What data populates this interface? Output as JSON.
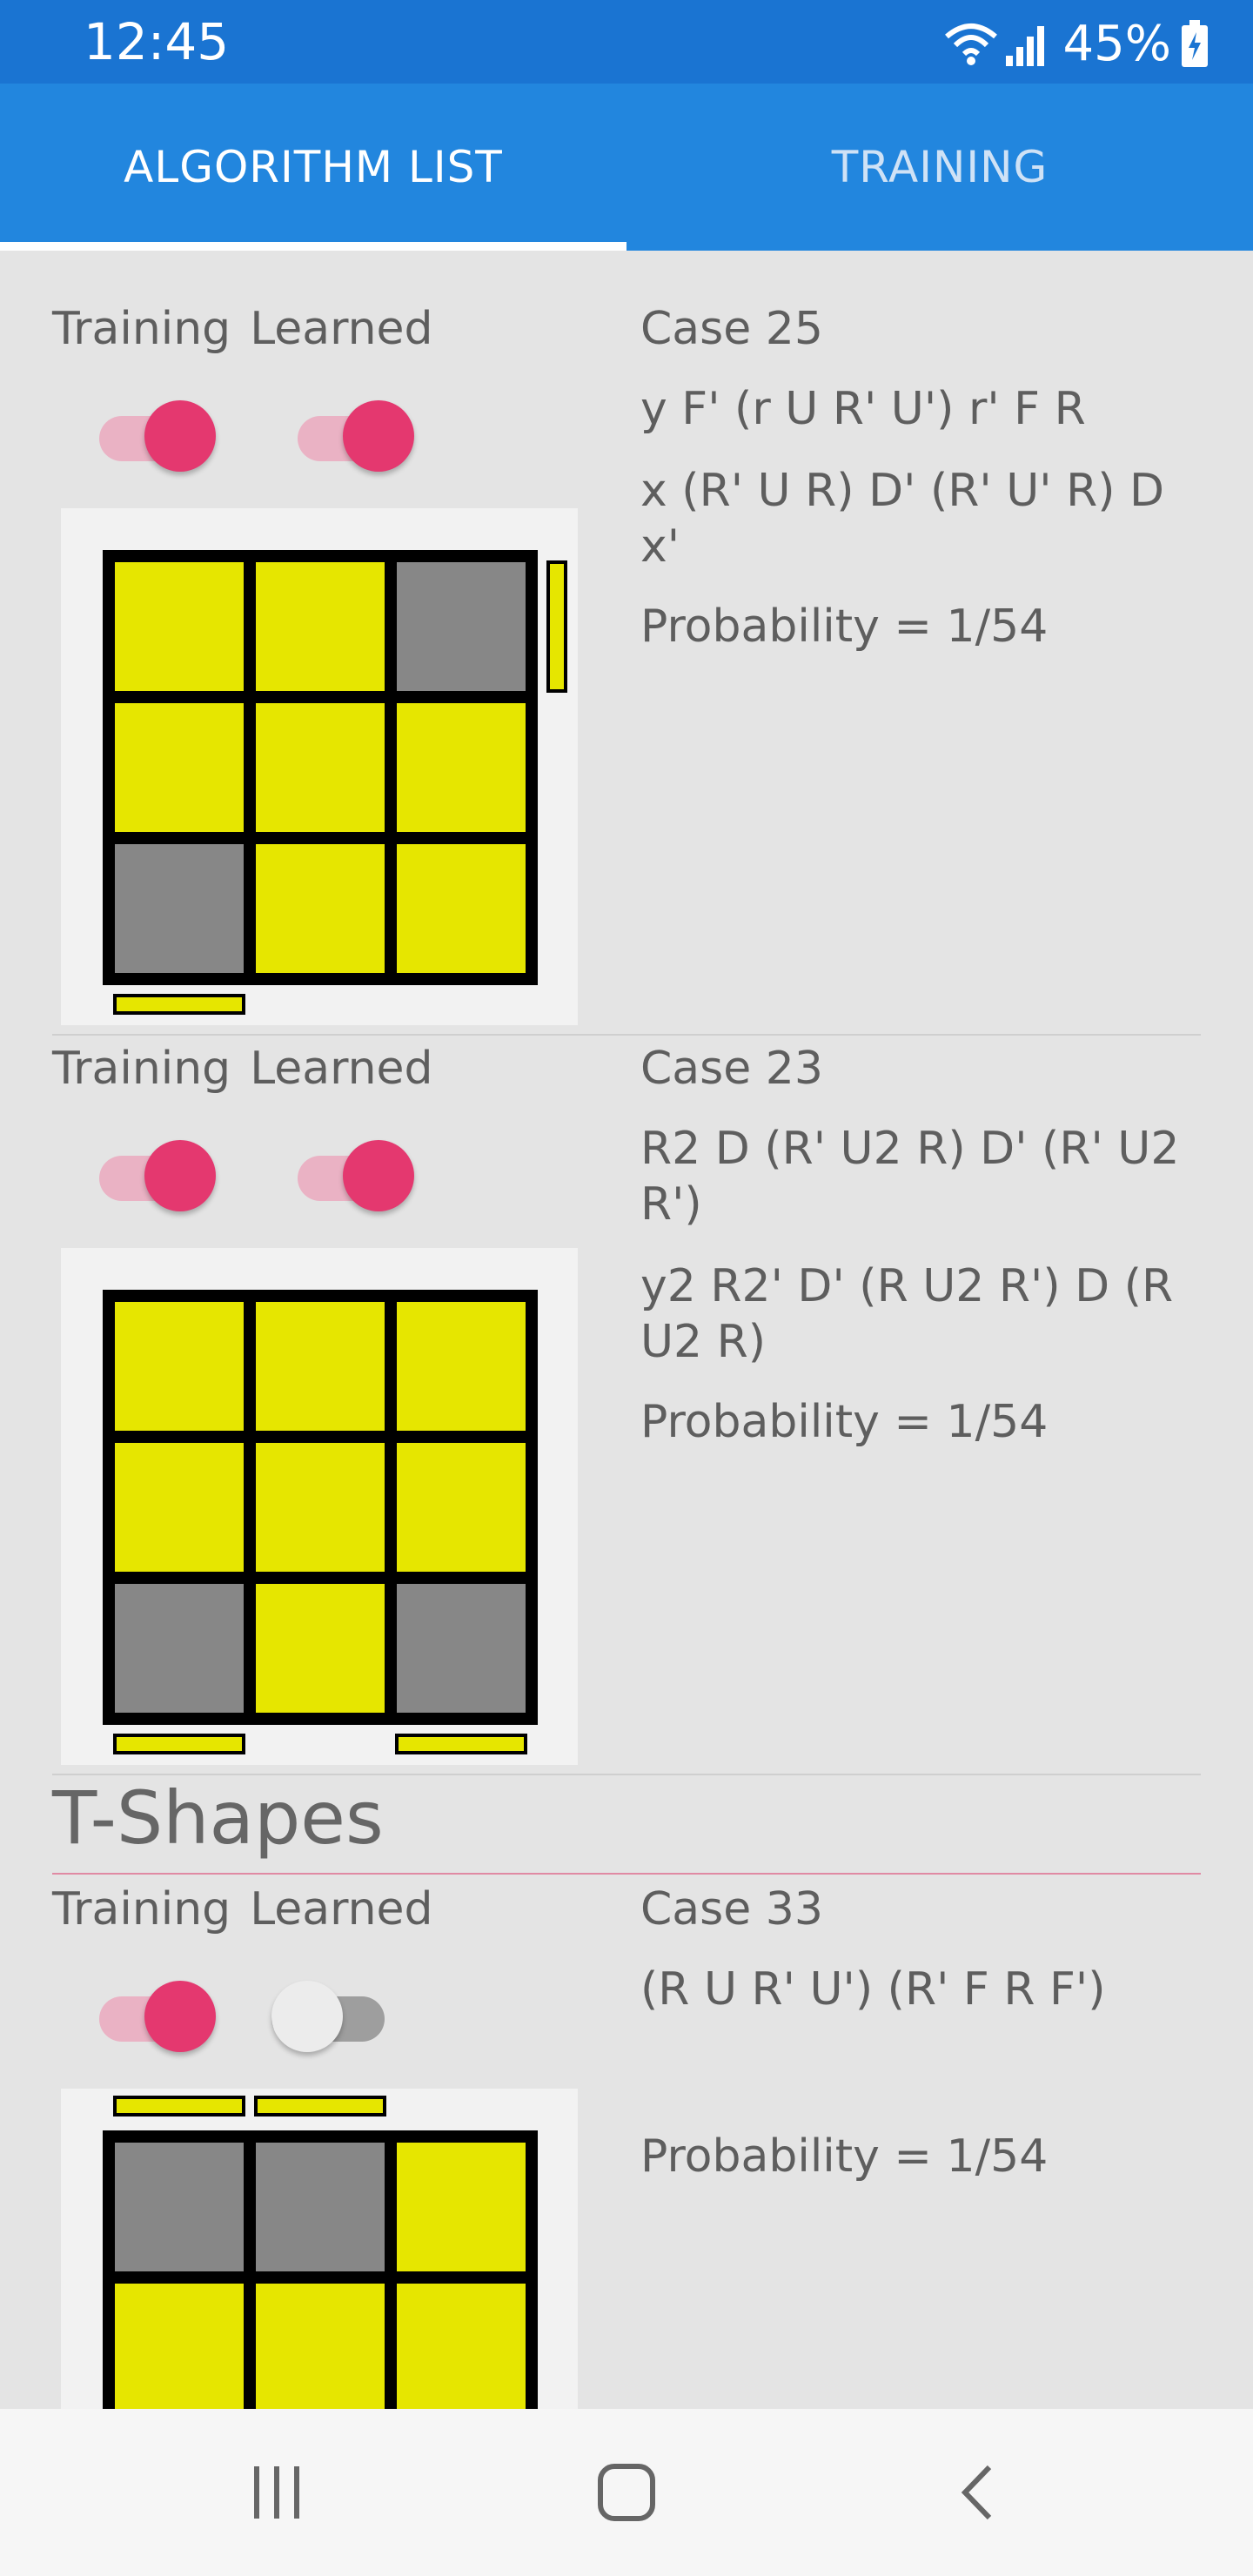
{
  "status_bar": {
    "time": "12:45",
    "battery": "45%",
    "icons": [
      "wifi-icon",
      "signal-icon",
      "battery-charging-icon"
    ]
  },
  "tabs": [
    {
      "label": "ALGORITHM LIST",
      "active": true
    },
    {
      "label": "TRAINING",
      "active": false
    }
  ],
  "labels": {
    "training": "Training",
    "learned": "Learned"
  },
  "cases": [
    {
      "title_prefix": "Case",
      "number": "25",
      "algorithms": [
        "y F' (r U R' U') r' F R",
        "x (R' U R) D' (R' U' R) D x'"
      ],
      "probability": "Probability = 1/54",
      "training_on": true,
      "learned_on": true
    },
    {
      "title_prefix": "Case",
      "number": "23",
      "algorithms": [
        "R2 D (R' U2 R) D' (R' U2 R')",
        "y2 R2' D' (R U2 R') D (R U2 R)"
      ],
      "probability": "Probability = 1/54",
      "training_on": true,
      "learned_on": true
    },
    {
      "title_prefix": "Case",
      "number": "33",
      "algorithms": [
        "(R U R' U') (R' F R F')"
      ],
      "probability": "Probability = 1/54",
      "training_on": true,
      "learned_on": false
    }
  ],
  "section": {
    "title": "T-Shapes"
  },
  "colors": {
    "status_bar": "#1a74d2",
    "tab_bar": "#2286de",
    "toggle_on": "#e4386f",
    "toggle_on_track": "#eab2c4",
    "toggle_off_track": "#9e9e9e",
    "sticker_yellow": "#e6e600",
    "sticker_gray": "#878787",
    "section_line": "#e08aa3"
  },
  "nav_bar": {
    "icons": [
      "recent-apps-icon",
      "home-icon",
      "back-icon"
    ]
  }
}
